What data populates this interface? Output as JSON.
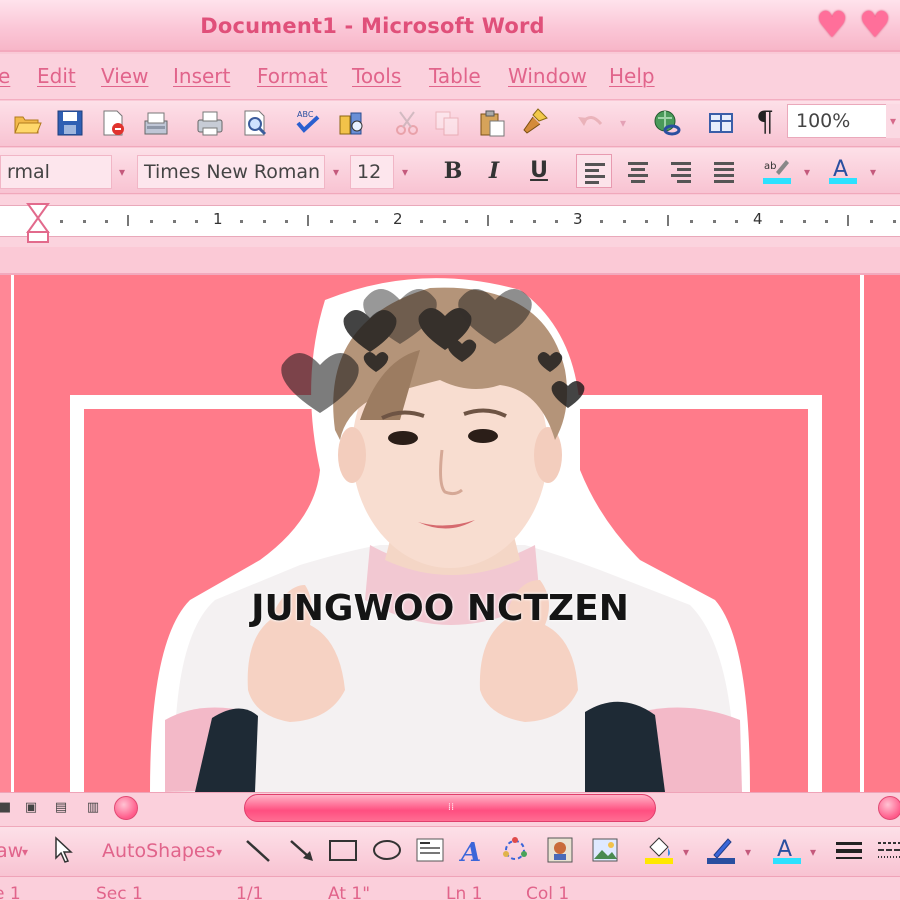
{
  "window": {
    "title": "Document1 - Microsoft Word"
  },
  "menu": {
    "items": [
      "e",
      "Edit",
      "View",
      "Insert",
      "Format",
      "Tools",
      "Table",
      "Window",
      "Help"
    ]
  },
  "toolbar": {
    "zoom": "100%",
    "pilcrow": "¶"
  },
  "formatting": {
    "style": "rmal",
    "font": "Times New Roman",
    "size": "12",
    "bold": "B",
    "italic": "I",
    "underline": "U",
    "alignment_active": "left"
  },
  "ruler": {
    "numbers": [
      "1",
      "2",
      "3",
      "4"
    ]
  },
  "document": {
    "overlay_text": "JUNGWOO NCTZEN"
  },
  "drawing": {
    "draw_label": "aw",
    "autoshapes_label": "AutoShapes"
  },
  "status": {
    "page": "e 1",
    "sec": "Sec 1",
    "pages": "1/1",
    "at": "At 1\"",
    "ln": "Ln 1",
    "col": "Col 1"
  },
  "colors": {
    "accent": "#e1648b",
    "document_bg": "#ff7b8a",
    "toolbar_bg": "#fbd1dd",
    "scrollbar": "#ff5b8a"
  },
  "icons": [
    "open-folder-icon",
    "save-icon",
    "permission-icon",
    "email-icon",
    "print-icon",
    "print-preview-icon",
    "spelling-icon",
    "research-icon",
    "cut-icon",
    "copy-icon",
    "paste-icon",
    "format-painter-icon",
    "undo-icon",
    "hyperlink-icon",
    "tables-borders-icon",
    "pilcrow-icon",
    "highlight-icon",
    "font-color-icon",
    "heart-icon"
  ]
}
